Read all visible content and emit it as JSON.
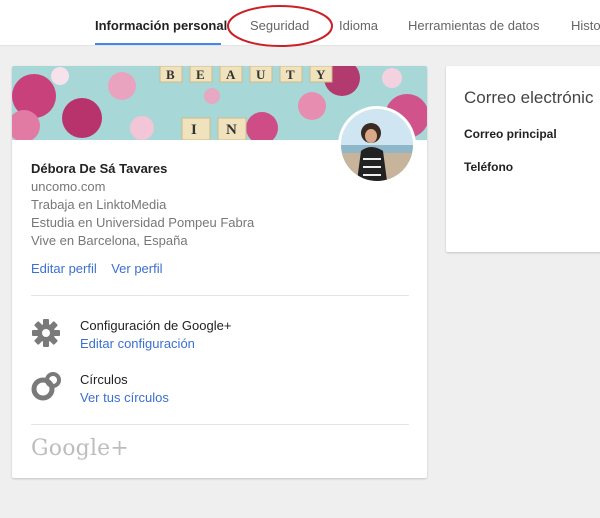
{
  "nav": {
    "tabs": [
      {
        "label": "Información personal",
        "active": true
      },
      {
        "label": "Seguridad",
        "highlighted": true
      },
      {
        "label": "Idioma"
      },
      {
        "label": "Herramientas de datos"
      },
      {
        "label": "Histo"
      }
    ],
    "accent_color": "#4285f4",
    "highlight_color": "#cc1f26"
  },
  "profile": {
    "cover_text": [
      "B",
      "E",
      "A",
      "U",
      "T",
      "Y",
      "I",
      "N"
    ],
    "name": "Débora De Sá Tavares",
    "info": [
      "uncomo.com",
      "Trabaja en LinktoMedia",
      "Estudia en Universidad Pompeu Fabra",
      "Vive en Barcelona, España"
    ],
    "links": {
      "edit": "Editar perfil",
      "view": "Ver perfil"
    },
    "settings": {
      "title": "Configuración de Google+",
      "link": "Editar configuración",
      "icon": "gear-icon"
    },
    "circles": {
      "title": "Círculos",
      "link": "Ver tus círculos",
      "icon": "circles-icon"
    },
    "footer_logo": "Google+",
    "link_color": "#3b6fd0"
  },
  "contact": {
    "title": "Correo electrónic",
    "labels": [
      "Correo principal",
      "Teléfono"
    ]
  }
}
